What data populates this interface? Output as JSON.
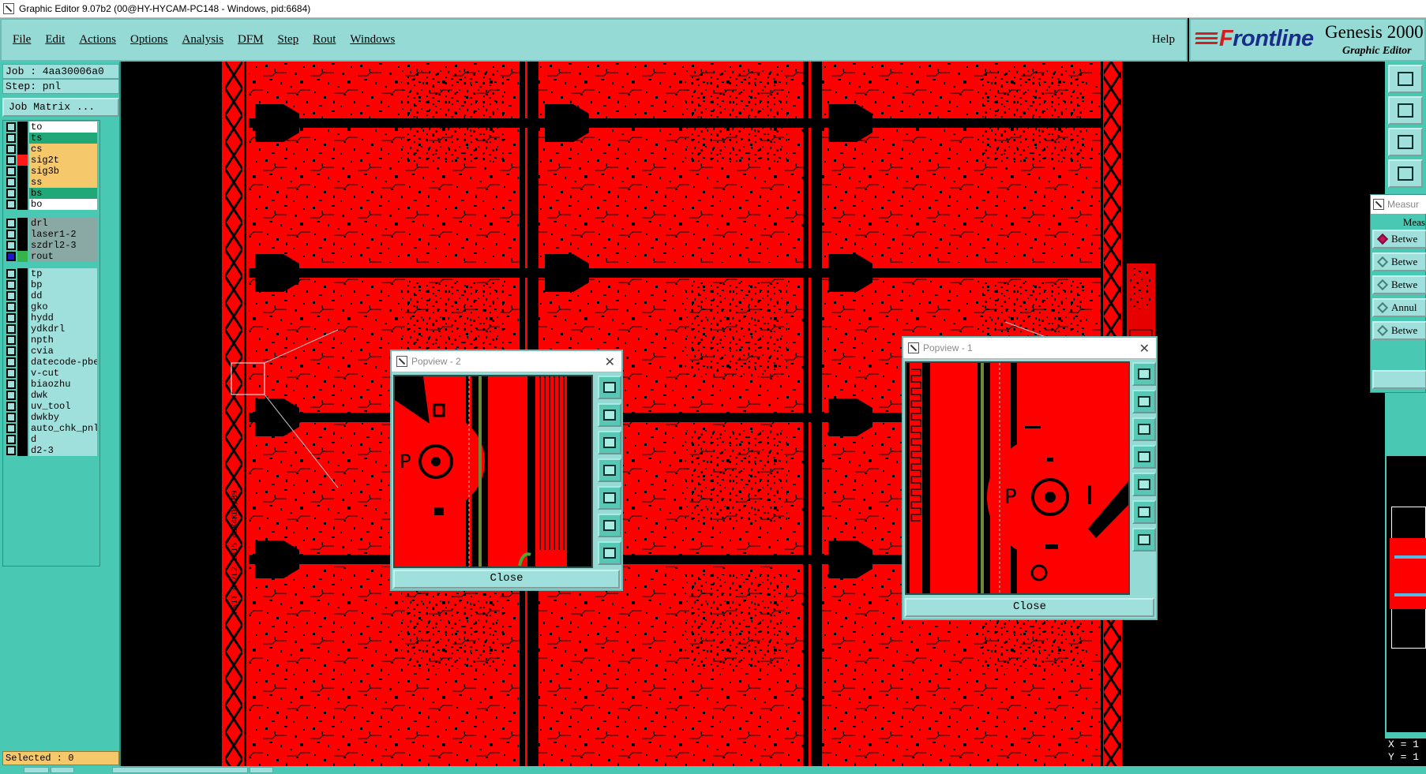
{
  "window": {
    "title": "Graphic Editor 9.07b2 (00@HY-HYCAM-PC148 - Windows, pid:6684)"
  },
  "menubar": {
    "items": [
      {
        "label": "File"
      },
      {
        "label": "Edit"
      },
      {
        "label": "Actions"
      },
      {
        "label": "Options"
      },
      {
        "label": "Analysis"
      },
      {
        "label": "DFM"
      },
      {
        "label": "Step"
      },
      {
        "label": "Rout"
      },
      {
        "label": "Windows"
      }
    ],
    "help_label": "Help"
  },
  "logo": {
    "brand_first": "F",
    "brand_rest": "rontline",
    "product": "Genesis 2000",
    "subtitle": "Graphic Editor"
  },
  "job": {
    "job_line": "Job : 4aa30006a0",
    "step_line": "Step: pnl",
    "job_matrix_label": "Job Matrix ..."
  },
  "layers": {
    "board": [
      {
        "name": "to",
        "color": "#ffffff",
        "swatch": "#000000",
        "checked": false
      },
      {
        "name": "ts",
        "color": "#20a878",
        "swatch": "#000000",
        "checked": false
      },
      {
        "name": "cs",
        "color": "#f5c96b",
        "swatch": "#000000",
        "checked": false
      },
      {
        "name": "sig2t",
        "color": "#f5c96b",
        "swatch": "#ff1a1a",
        "checked": false
      },
      {
        "name": "sig3b",
        "color": "#f5c96b",
        "swatch": "#000000",
        "checked": false
      },
      {
        "name": "ss",
        "color": "#f5c96b",
        "swatch": "#000000",
        "checked": false
      },
      {
        "name": "bs",
        "color": "#20a878",
        "swatch": "#000000",
        "checked": false
      },
      {
        "name": "bo",
        "color": "#ffffff",
        "swatch": "#000000",
        "checked": false
      }
    ],
    "drill": [
      {
        "name": "drl",
        "color": "#8aa9a4",
        "swatch": "#000000",
        "checked": false
      },
      {
        "name": "laser1-2",
        "color": "#8aa9a4",
        "swatch": "#000000",
        "checked": false
      },
      {
        "name": "szdrl2-3",
        "color": "#8aa9a4",
        "swatch": "#000000",
        "checked": false
      },
      {
        "name": "rout",
        "color": "#8aa9a4",
        "swatch": "#36b34a",
        "checked": true
      }
    ],
    "misc": [
      {
        "name": "tp",
        "color": "#9fe0dc",
        "swatch": "#000000",
        "checked": false
      },
      {
        "name": "bp",
        "color": "#9fe0dc",
        "swatch": "#000000",
        "checked": false
      },
      {
        "name": "dd",
        "color": "#9fe0dc",
        "swatch": "#000000",
        "checked": false
      },
      {
        "name": "gko",
        "color": "#9fe0dc",
        "swatch": "#000000",
        "checked": false
      },
      {
        "name": "hydd",
        "color": "#9fe0dc",
        "swatch": "#000000",
        "checked": false
      },
      {
        "name": "ydkdrl",
        "color": "#9fe0dc",
        "swatch": "#000000",
        "checked": false
      },
      {
        "name": "npth",
        "color": "#9fe0dc",
        "swatch": "#000000",
        "checked": false
      },
      {
        "name": "cvia",
        "color": "#9fe0dc",
        "swatch": "#000000",
        "checked": false
      },
      {
        "name": "datecode-pbe",
        "color": "#9fe0dc",
        "swatch": "#000000",
        "checked": false
      },
      {
        "name": "v-cut",
        "color": "#9fe0dc",
        "swatch": "#000000",
        "checked": false
      },
      {
        "name": "biaozhu",
        "color": "#9fe0dc",
        "swatch": "#000000",
        "checked": false
      },
      {
        "name": "dwk",
        "color": "#9fe0dc",
        "swatch": "#000000",
        "checked": false
      },
      {
        "name": "uv_tool",
        "color": "#9fe0dc",
        "swatch": "#000000",
        "checked": false
      },
      {
        "name": "dwkby",
        "color": "#9fe0dc",
        "swatch": "#000000",
        "checked": false
      },
      {
        "name": "auto_chk_pnl",
        "color": "#9fe0dc",
        "swatch": "#000000",
        "checked": false
      },
      {
        "name": "d",
        "color": "#9fe0dc",
        "swatch": "#000000",
        "checked": false
      },
      {
        "name": "d2-3",
        "color": "#9fe0dc",
        "swatch": "#000000",
        "checked": false
      }
    ]
  },
  "status": {
    "selected_line": "Selected : 0"
  },
  "popview1": {
    "title": "Popview - 1",
    "close_label": "Close"
  },
  "popview2": {
    "title": "Popview - 2",
    "close_label": "Close"
  },
  "measure": {
    "title": "Measur",
    "header": "Meas",
    "options": [
      {
        "label": "Betwe",
        "selected": true
      },
      {
        "label": "Betwe",
        "selected": false
      },
      {
        "label": "Betwe",
        "selected": false
      },
      {
        "label": "Annul",
        "selected": false
      },
      {
        "label": "Betwe",
        "selected": false
      }
    ]
  },
  "coords": {
    "x_line": "X = 1",
    "y_line": "Y = 1"
  },
  "colors": {
    "pcb_red": "#ff0000",
    "panel_teal": "#49c8b3",
    "menu_bg": "#96dad5",
    "selected_bg": "#f5c96b"
  }
}
